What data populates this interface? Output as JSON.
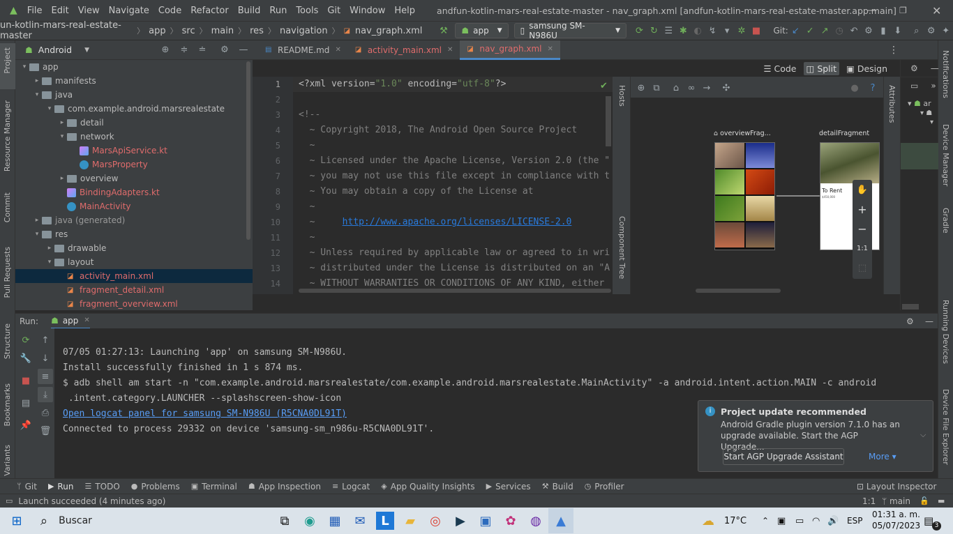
{
  "titlebar": {
    "menu": [
      "File",
      "Edit",
      "View",
      "Navigate",
      "Code",
      "Refactor",
      "Build",
      "Run",
      "Tools",
      "Git",
      "Window",
      "Help"
    ],
    "title": "andfun-kotlin-mars-real-estate-master - nav_graph.xml [andfun-kotlin-mars-real-estate-master.app.main]"
  },
  "navbar": {
    "breadcrumbs": [
      "un-kotlin-mars-real-estate-master",
      "app",
      "src",
      "main",
      "res",
      "navigation",
      "nav_graph.xml"
    ],
    "run_config": "app",
    "device": "samsung SM-N986U",
    "git_label": "Git:"
  },
  "left_strip": [
    "Project",
    "Resource Manager",
    "Commit",
    "Pull Requests",
    "Structure",
    "Bookmarks",
    "Variants"
  ],
  "right_strip": [
    "Notifications",
    "Device Manager",
    "Gradle",
    "Running Devices",
    "Device File Explorer"
  ],
  "project": {
    "view": "Android",
    "tree": [
      {
        "label": "app",
        "kind": "folder",
        "indent": 0,
        "arrow": "▾"
      },
      {
        "label": "manifests",
        "kind": "folder",
        "indent": 1,
        "arrow": "▸"
      },
      {
        "label": "java",
        "kind": "folder",
        "indent": 1,
        "arrow": "▾"
      },
      {
        "label": "com.example.android.marsrealestate",
        "kind": "folder",
        "indent": 2,
        "arrow": "▾"
      },
      {
        "label": "detail",
        "kind": "folder",
        "indent": 3,
        "arrow": "▸"
      },
      {
        "label": "network",
        "kind": "folder",
        "indent": 3,
        "arrow": "▾"
      },
      {
        "label": "MarsApiService.kt",
        "kind": "kt",
        "indent": 4,
        "arrow": "",
        "red": true
      },
      {
        "label": "MarsProperty",
        "kind": "class",
        "indent": 4,
        "arrow": "",
        "red": true
      },
      {
        "label": "overview",
        "kind": "folder",
        "indent": 3,
        "arrow": "▸"
      },
      {
        "label": "BindingAdapters.kt",
        "kind": "kt",
        "indent": 3,
        "arrow": "",
        "red": true
      },
      {
        "label": "MainActivity",
        "kind": "class",
        "indent": 3,
        "arrow": "",
        "red": true
      },
      {
        "label": "java (generated)",
        "kind": "folder",
        "indent": 1,
        "arrow": "▸",
        "gray": true
      },
      {
        "label": "res",
        "kind": "folder",
        "indent": 1,
        "arrow": "▾"
      },
      {
        "label": "drawable",
        "kind": "folder",
        "indent": 2,
        "arrow": "▸"
      },
      {
        "label": "layout",
        "kind": "folder",
        "indent": 2,
        "arrow": "▾"
      },
      {
        "label": "activity_main.xml",
        "kind": "xml",
        "indent": 3,
        "arrow": "",
        "red": true,
        "selected": true
      },
      {
        "label": "fragment_detail.xml",
        "kind": "xml",
        "indent": 3,
        "arrow": "",
        "red": true
      },
      {
        "label": "fragment_overview.xml",
        "kind": "xml",
        "indent": 3,
        "arrow": "",
        "red": true
      }
    ]
  },
  "editor_tabs": [
    {
      "label": "README.md",
      "active": false
    },
    {
      "label": "activity_main.xml",
      "active": false
    },
    {
      "label": "nav_graph.xml",
      "active": true
    }
  ],
  "view_modes": [
    "Code",
    "Split",
    "Design"
  ],
  "code_lines": [
    {
      "n": "1",
      "parts": [
        {
          "t": "<?xml version=",
          "c": ""
        },
        {
          "t": "\"1.0\"",
          "c": "str"
        },
        {
          "t": " encoding=",
          "c": ""
        },
        {
          "t": "\"utf-8\"",
          "c": "str"
        },
        {
          "t": "?>",
          "c": ""
        }
      ]
    },
    {
      "n": "2",
      "parts": []
    },
    {
      "n": "3",
      "parts": [
        {
          "t": "<!--",
          "c": "cm"
        }
      ]
    },
    {
      "n": "4",
      "parts": [
        {
          "t": "  ~ Copyright 2018, The Android Open Source Project",
          "c": "cm"
        }
      ]
    },
    {
      "n": "5",
      "parts": [
        {
          "t": "  ~",
          "c": "cm"
        }
      ]
    },
    {
      "n": "6",
      "parts": [
        {
          "t": "  ~ Licensed under the Apache License, Version 2.0 (the \"",
          "c": "cm"
        }
      ]
    },
    {
      "n": "7",
      "parts": [
        {
          "t": "  ~ you may not use this file except in compliance with t",
          "c": "cm"
        }
      ]
    },
    {
      "n": "8",
      "parts": [
        {
          "t": "  ~ You may obtain a copy of the License at",
          "c": "cm"
        }
      ]
    },
    {
      "n": "9",
      "parts": [
        {
          "t": "  ~",
          "c": "cm"
        }
      ]
    },
    {
      "n": "10",
      "parts": [
        {
          "t": "  ~     ",
          "c": "cm"
        },
        {
          "t": "http://www.apache.org/licenses/LICENSE-2.0",
          "c": "link"
        }
      ]
    },
    {
      "n": "11",
      "parts": [
        {
          "t": "  ~",
          "c": "cm"
        }
      ]
    },
    {
      "n": "12",
      "parts": [
        {
          "t": "  ~ Unless required by applicable law or agreed to in wri",
          "c": "cm"
        }
      ]
    },
    {
      "n": "13",
      "parts": [
        {
          "t": "  ~ distributed under the License is distributed on an \"A",
          "c": "cm"
        }
      ]
    },
    {
      "n": "14",
      "parts": [
        {
          "t": "  ~ WITHOUT WARRANTIES OR CONDITIONS OF ANY KIND, either",
          "c": "cm"
        }
      ]
    }
  ],
  "designer": {
    "side_tabs": [
      "Hosts",
      "Component Tree"
    ],
    "attributes_tab": "Attributes",
    "fragment1": "overviewFrag...",
    "fragment2": "detailFragment",
    "detail_title": "To Rent",
    "detail_price": "$450,000",
    "zoom_label": "1:1",
    "minimap_label": "ar"
  },
  "run": {
    "label": "Run:",
    "tab": "app",
    "console": [
      {
        "t": "07/05 01:27:13: Launching 'app' on samsung SM-N986U.",
        "link": false
      },
      {
        "t": "Install successfully finished in 1 s 874 ms.",
        "link": false
      },
      {
        "t": "$ adb shell am start -n \"com.example.android.marsrealestate/com.example.android.marsrealestate.MainActivity\" -a android.intent.action.MAIN -c android",
        "link": false
      },
      {
        "t": " .intent.category.LAUNCHER --splashscreen-show-icon",
        "link": false
      },
      {
        "t": "Open logcat panel for samsung SM-N986U (R5CNA0DL91T)",
        "link": true
      },
      {
        "t": "Connected to process 29332 on device 'samsung-sm_n986u-R5CNA0DL91T'.",
        "link": false
      }
    ]
  },
  "notification": {
    "title": "Project update recommended",
    "body": "Android Gradle plugin version 7.1.0 has an upgrade available. Start the AGP Upgrade...",
    "action": "Start AGP Upgrade Assistant",
    "more": "More ▾"
  },
  "tool_windows": [
    "Git",
    "Run",
    "TODO",
    "Problems",
    "Terminal",
    "App Inspection",
    "Logcat",
    "App Quality Insights",
    "Services",
    "Build",
    "Profiler"
  ],
  "layout_inspector": "Layout Inspector",
  "status": {
    "message": "Launch succeeded (4 minutes ago)",
    "position": "1:1",
    "branch": "main"
  },
  "taskbar": {
    "search": "Buscar",
    "temperature": "17°C",
    "language": "ESP",
    "time": "01:31 a. m.",
    "date": "05/07/2023",
    "notif_count": "3"
  },
  "colors": {
    "accent": "#4a88c7",
    "selection": "#0d293e",
    "error_file": "#e06c6c"
  }
}
